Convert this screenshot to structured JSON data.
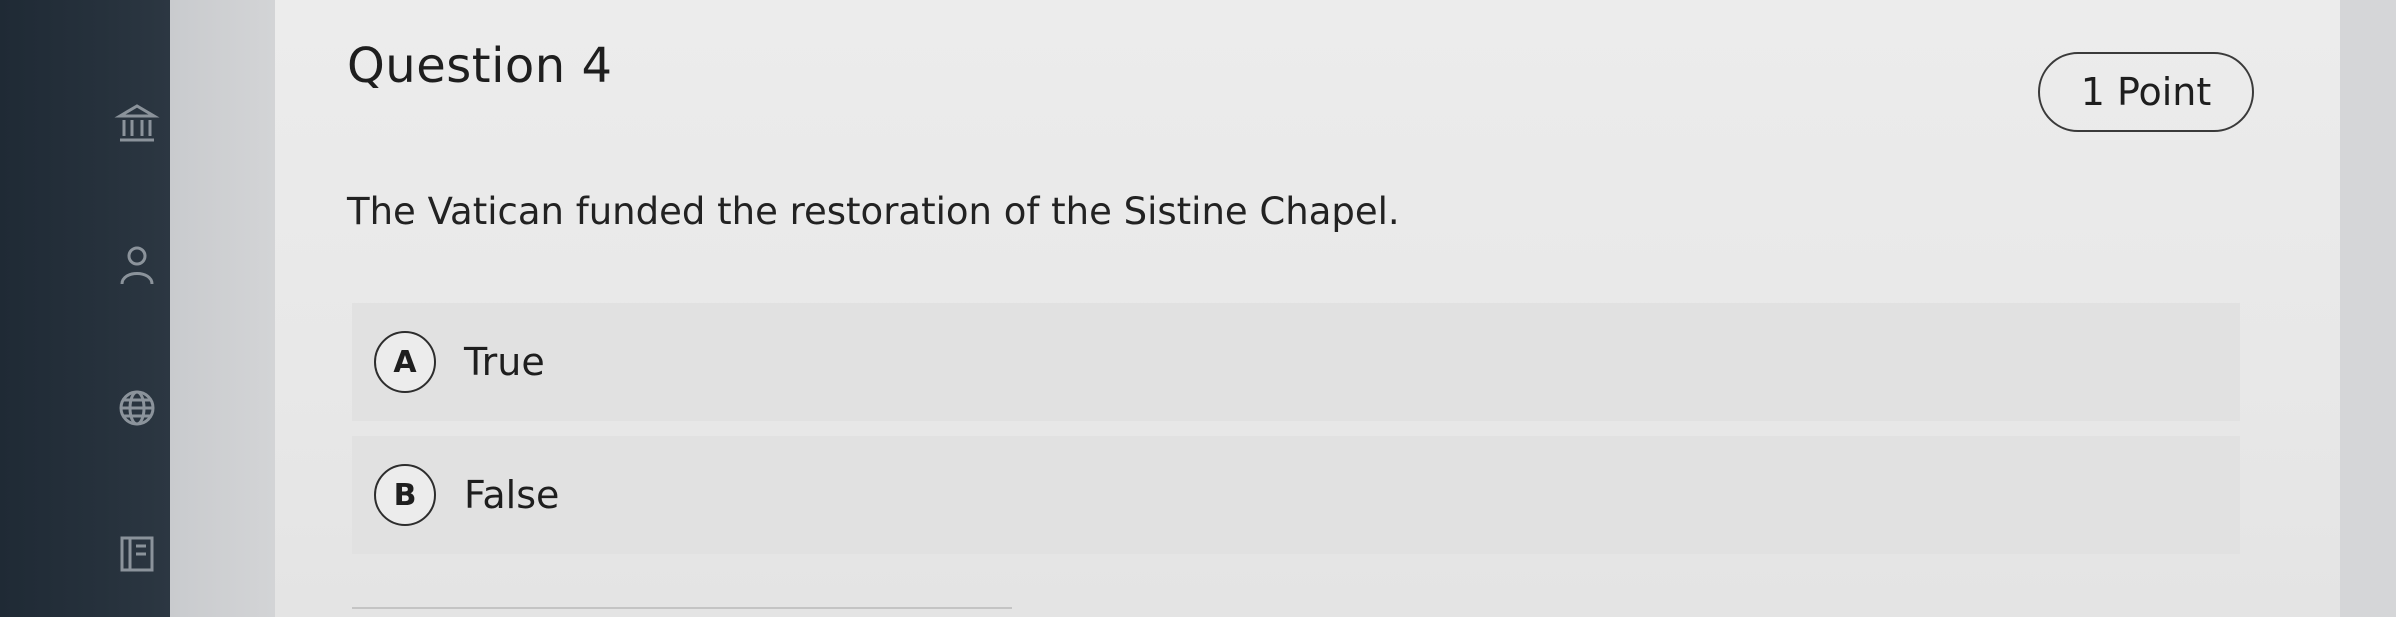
{
  "nav": {
    "icons": [
      "institution-icon",
      "person-icon",
      "globe-icon",
      "book-icon"
    ]
  },
  "question": {
    "title": "Question 4",
    "points": "1 Point",
    "text": "The Vatican funded the restoration of the Sistine Chapel.",
    "options": [
      {
        "letter": "A",
        "label": "True"
      },
      {
        "letter": "B",
        "label": "False"
      }
    ]
  }
}
